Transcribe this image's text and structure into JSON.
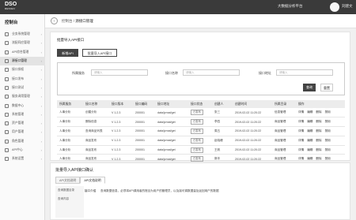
{
  "header": {
    "logo_text": "DSO",
    "logo_sub": "DESIGN",
    "platform": "大数据分析平台",
    "username": "刘建文"
  },
  "sidebar": {
    "title": "控制台",
    "items": [
      {
        "label": "业务系统管理",
        "active": false
      },
      {
        "label": "流配同应管理",
        "active": false
      },
      {
        "label": "API综合管理",
        "active": false
      },
      {
        "label": "源接口管理",
        "active": true
      },
      {
        "label": "接口授权",
        "active": false
      },
      {
        "label": "接口发布",
        "active": false
      },
      {
        "label": "接口测试",
        "active": false
      },
      {
        "label": "服务调用管理",
        "active": false
      },
      {
        "label": "数据中心",
        "active": false
      },
      {
        "label": "系统管理",
        "active": false
      },
      {
        "label": "资产管理",
        "active": false
      },
      {
        "label": "用户管理",
        "active": false
      },
      {
        "label": "角色管理",
        "active": false
      },
      {
        "label": "API中心",
        "active": false
      },
      {
        "label": "系统设置",
        "active": false
      }
    ]
  },
  "breadcrumb": {
    "back": "‹",
    "root": "控制台",
    "sep": "/",
    "current": "源接口管理"
  },
  "main": {
    "title": "批量导入API接口",
    "tab_new": "新增API",
    "tab_batch": "批量导入API接口",
    "filter": {
      "label1": "所属服务",
      "ph1": "请输入",
      "label2": "接口名称",
      "ph2": "请输入",
      "label3": "接口地址",
      "ph3": "请输入",
      "query": "查询",
      "reset": "重置"
    },
    "table": {
      "headers": [
        "所属服务",
        "接口名称",
        "接口版本",
        "接口编码",
        "接口地址",
        "接口状态",
        "创建人",
        "创建时间",
        "所属目录",
        "操作"
      ],
      "rows": [
        [
          "人事分析",
          "创建分析",
          "V 1.2.3",
          "200001",
          "data/jzmat/get",
          "已发布",
          "张三",
          "2019-02-02 11:20:22",
          "信息管理"
        ],
        [
          "人事分析",
          "删除信息",
          "V 1.2.3",
          "200001",
          "data/jzmat/get",
          "已发布",
          "李四",
          "2019-02-02 11:20:22",
          "商品管理"
        ],
        [
          "人事分析",
          "查询商品列表",
          "V 1.2.3",
          "200001",
          "data/jzmat/get",
          "已发布",
          "周五",
          "2019-02-02 11:20:22",
          "商品管理"
        ],
        [
          "人事分析",
          "商品发布",
          "V 1.2.3",
          "200001",
          "data/jzmat/get",
          "已发布",
          "赵晓峰",
          "2019-02-02 11:20:22",
          "商品管理"
        ],
        [
          "人事分析",
          "商品发布",
          "V 1.2.3",
          "200001",
          "data/jzmat/get",
          "已发布",
          "王帆",
          "2019-02-02 11:20:22",
          "商品管理"
        ],
        [
          "人事分析",
          "商品发布",
          "V 1.2.3",
          "200001",
          "data/jzmat/get",
          "已发布",
          "郭丰",
          "2019-02-02 11:20:22",
          "商品管理"
        ]
      ],
      "actions": [
        "详情",
        "编辑",
        "删除",
        "禁用"
      ]
    }
  },
  "import_panel": {
    "title": "批量导入API接口确认",
    "tab1": "API文档说明",
    "tab2": "API文档说明",
    "side1": "查询数据目录",
    "side2": "查询内容",
    "row_key": "接口介绍",
    "row_val": "查询数据信息，必须将API调用者的账目为用户的管理员，以及接可调数据量及返回用户的数据"
  }
}
